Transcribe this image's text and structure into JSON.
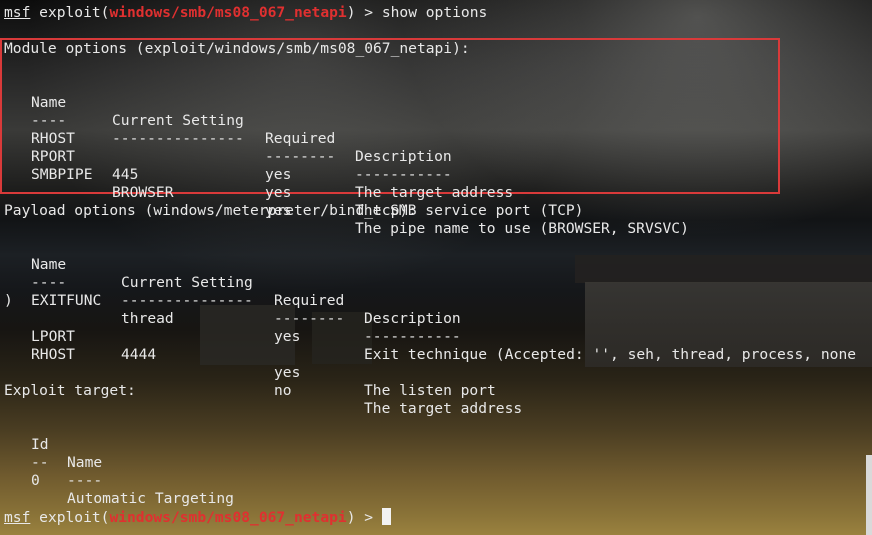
{
  "prompt": {
    "msf": "msf",
    "exploit_word": "exploit(",
    "module": "windows/smb/ms08_067_netapi",
    "close": ") > ",
    "command": "show options"
  },
  "module_options": {
    "header": "Module options (exploit/windows/smb/ms08_067_netapi):",
    "columns": [
      "Name",
      "Current Setting",
      "Required",
      "Description"
    ],
    "dashes": [
      "----",
      "---------------",
      "--------",
      "-----------"
    ],
    "rows": [
      [
        "RHOST",
        "",
        "yes",
        "The target address"
      ],
      [
        "RPORT",
        "445",
        "yes",
        "The SMB service port (TCP)"
      ],
      [
        "SMBPIPE",
        "BROWSER",
        "yes",
        "The pipe name to use (BROWSER, SRVSVC)"
      ]
    ]
  },
  "payload_options": {
    "header": "Payload options (windows/meterpreter/bind_tcp):",
    "columns": [
      "Name",
      "Current Setting",
      "Required",
      "Description"
    ],
    "dashes": [
      "----",
      "---------------",
      "--------",
      "-----------"
    ],
    "rows": [
      [
        "EXITFUNC",
        "thread",
        "yes",
        "Exit technique (Accepted: '', seh, thread, process, none"
      ],
      [
        "LPORT",
        "4444",
        "yes",
        "The listen port"
      ],
      [
        "RHOST",
        "",
        "no",
        "The target address"
      ]
    ],
    "wrap": ")"
  },
  "exploit_target": {
    "header": "Exploit target:",
    "columns": [
      "Id",
      "Name"
    ],
    "dashes": [
      "--",
      "----"
    ],
    "rows": [
      [
        "0",
        "Automatic Targeting"
      ]
    ]
  },
  "colors": {
    "module_red": "#e03030",
    "highlight_box": "#d93a3a",
    "text": "#e8e8e8"
  }
}
